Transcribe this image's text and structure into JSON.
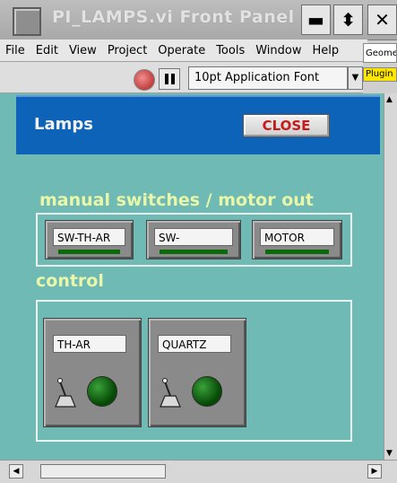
{
  "window": {
    "title": "PI_LAMPS.vi Front Panel",
    "minimize_glyph": "▬",
    "maximize_glyph": "⬍",
    "close_glyph": "✕"
  },
  "menu": [
    "File",
    "Edit",
    "View",
    "Project",
    "Operate",
    "Tools",
    "Window",
    "Help"
  ],
  "side_windows": {
    "geometry": "Geome",
    "plugin": "Plugin"
  },
  "toolbar": {
    "font": "10pt Application Font",
    "dropdown_glyph": "▼"
  },
  "panel": {
    "title": "Lamps",
    "close_label": "CLOSE",
    "manual_section": "manual switches / motor out",
    "control_section": "control",
    "switches": [
      "SW-TH-AR",
      "SW-",
      "MOTOR"
    ],
    "lamps": [
      "TH-AR",
      "QUARTZ"
    ]
  },
  "icons": {
    "app": "labview-app-icon",
    "run": "run-button-icon",
    "pause": "pause-icon"
  },
  "colors": {
    "panel_bg": "#6fbab5",
    "header_bg": "#0c63b7",
    "close_text": "#c61b1b",
    "section_text": "#e8f7a8",
    "led_on": "#0a6a0a"
  }
}
